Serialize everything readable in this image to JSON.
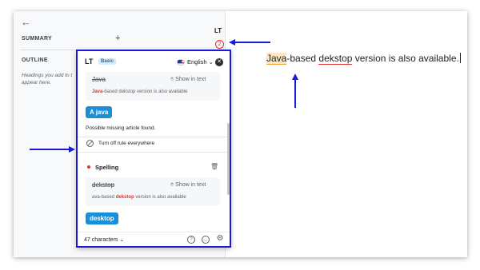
{
  "sidebar": {
    "back_glyph": "←",
    "summary_label": "SUMMARY",
    "summary_add": "+",
    "outline_label": "OUTLINE",
    "outline_hint": "Headings you add to t appear here."
  },
  "extension": {
    "logo": "LT",
    "error_count": "2"
  },
  "document": {
    "word_java": "Java",
    "text_mid": "-based ",
    "word_dekstop": "dekstop",
    "text_end": " version is also available."
  },
  "popup": {
    "logo": "LT",
    "plan_badge": "Basic",
    "language": "English ⌄",
    "close_glyph": "✕",
    "show_in_text": "Show in text",
    "match1": {
      "original": "Java",
      "context_prefix": "",
      "context_highlight": "Java",
      "context_suffix": "-based dekstop version is also available",
      "suggestion": "A java",
      "message": "Possible missing article found.",
      "turn_off": "Turn off rule everywhere"
    },
    "match2": {
      "section_title": "Spelling",
      "original": "dekstop",
      "context_prefix": "ava-based ",
      "context_highlight": "dekstop",
      "context_suffix": " version is also available",
      "suggestion": "desktop"
    },
    "footer": {
      "char_count": "47 characters ⌄",
      "help_glyph": "?",
      "settings_glyph": "⚙"
    }
  },
  "colors": {
    "annotation_blue": "#1a1adb",
    "suggestion_blue": "#1a8fd8",
    "error_red": "#e03131"
  }
}
